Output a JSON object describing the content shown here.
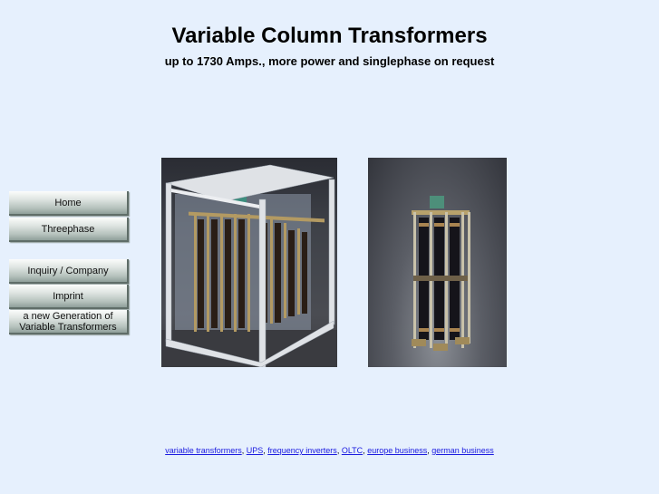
{
  "header": {
    "title": "Variable Column Transformers",
    "subtitle": "up to 1730 Amps., more power and singlephase on request"
  },
  "nav": {
    "items": [
      {
        "label": "Home"
      },
      {
        "label": "Threephase"
      },
      {
        "label": "Inquiry / Company"
      },
      {
        "label": "Imprint"
      },
      {
        "label": "a new Generation of Variable Transformers"
      }
    ]
  },
  "images": [
    {
      "alt": "Threephase variable column transformer in frame"
    },
    {
      "alt": "Single column variable transformer"
    }
  ],
  "footer": {
    "links": [
      {
        "label": "variable transformers"
      },
      {
        "label": "UPS"
      },
      {
        "label": "frequency inverters"
      },
      {
        "label": "OLTC"
      },
      {
        "label": "europe business"
      },
      {
        "label": "german business"
      }
    ],
    "separator": ", "
  },
  "colors": {
    "background": "#e6f0fd",
    "link": "#1a1ae0"
  }
}
